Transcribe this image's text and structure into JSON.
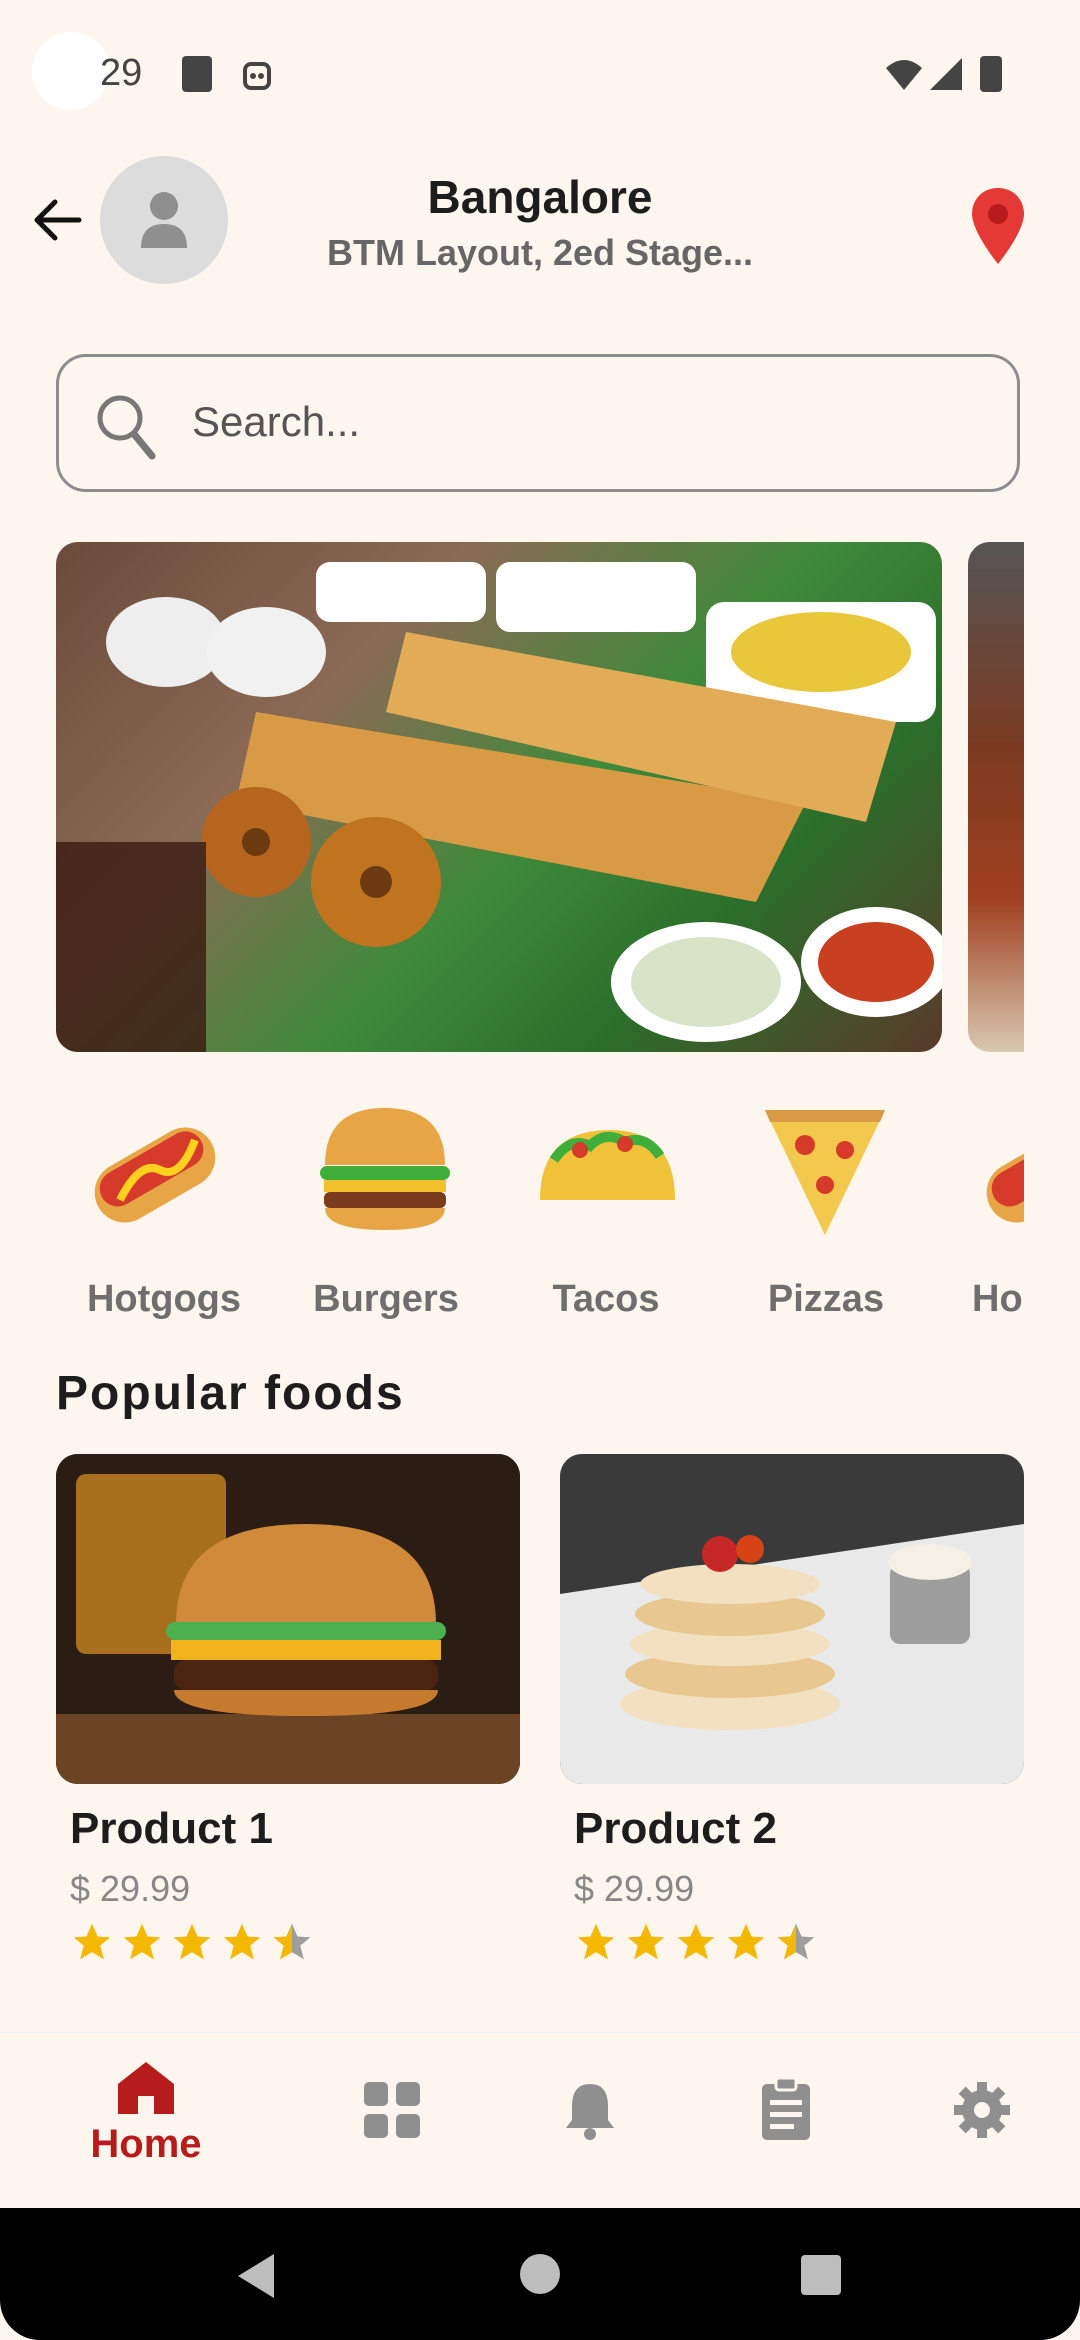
{
  "status_bar": {
    "time": "29"
  },
  "header": {
    "city": "Bangalore",
    "area": "BTM Layout, 2ed Stage...",
    "back_icon": "arrow-left-icon",
    "avatar_icon": "person-icon",
    "location_icon": "map-pin-icon"
  },
  "search": {
    "placeholder": "Search...",
    "value": ""
  },
  "categories": [
    {
      "label": "Hotgogs",
      "icon": "hotdog-icon"
    },
    {
      "label": "Burgers",
      "icon": "burger-icon"
    },
    {
      "label": "Tacos",
      "icon": "taco-icon"
    },
    {
      "label": "Pizzas",
      "icon": "pizza-icon"
    },
    {
      "label": "Ho",
      "icon": "hotdog-icon"
    }
  ],
  "popular": {
    "title": "Popular foods",
    "products": [
      {
        "name": "Product 1",
        "price": "$ 29.99",
        "rating": 4.5
      },
      {
        "name": "Product 2",
        "price": "$ 29.99",
        "rating": 4.5
      }
    ]
  },
  "bottom_nav": {
    "active_label": "Home",
    "items": [
      "home-icon",
      "grid-icon",
      "bell-icon",
      "clipboard-icon",
      "gear-icon"
    ]
  },
  "colors": {
    "accent": "#b71c1c",
    "background": "#fdf6ef",
    "star": "#f5b800"
  }
}
